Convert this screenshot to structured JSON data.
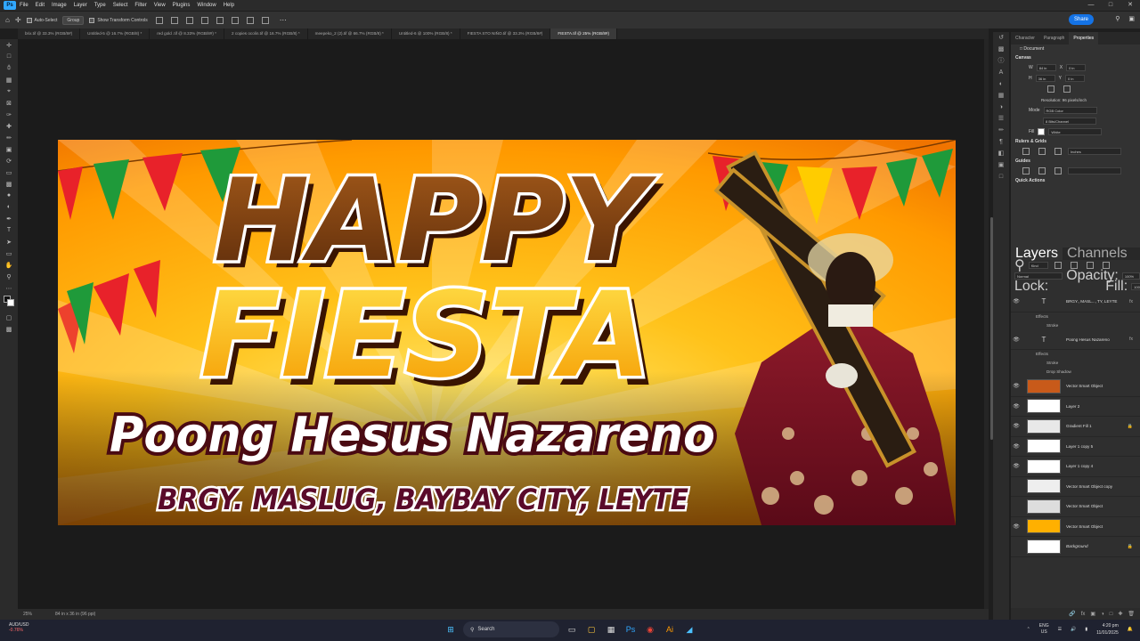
{
  "menubar": {
    "app_logo": "Ps",
    "items": [
      "File",
      "Edit",
      "Image",
      "Layer",
      "Type",
      "Select",
      "Filter",
      "View",
      "Plugins",
      "Window",
      "Help"
    ]
  },
  "optbar": {
    "auto_select_label": "Auto-Select",
    "auto_select_value": "Group",
    "transform_label": "Show Transform Controls",
    "share_label": "Share"
  },
  "tabs": [
    {
      "label": "brix.tif @ 33.3% (RGB/8#)"
    },
    {
      "label": "Untitled-5 @ 16.7% (RGB/8) *"
    },
    {
      "label": "red gold .tif @ 8.33% (RGB/8#) *"
    },
    {
      "label": "2 copies ocolin.tif @ 16.7% (RGB/8) *"
    },
    {
      "label": "meepeko_2 (2).tif @ 66.7% (RGB/8) *"
    },
    {
      "label": "Untitled-6 @ 100% (RGB/8) *"
    },
    {
      "label": "FIESTA STO NIÑO.tif @ 33.3% (RGB/8#)"
    },
    {
      "label": "FIESTA.tif @ 25% (RGB/8#)"
    }
  ],
  "artwork": {
    "line1": "HAPPY",
    "line2": "FIESTA",
    "line3": "Poong Hesus Nazareno",
    "line4": "BRGY. MASLUG, BAYBAY CITY, LEYTE"
  },
  "status": {
    "zoom": "25%",
    "doc_size": "84 in x 36 in (96 ppi)"
  },
  "panel": {
    "tabs": [
      "Character",
      "Paragraph",
      "Properties"
    ],
    "doc_label": "Document",
    "canvas_title": "Canvas",
    "w_label": "W",
    "w_value": "84 in",
    "h_label": "H",
    "h_value": "36 in",
    "x_label": "X",
    "x_value": "0 in",
    "y_label": "Y",
    "y_value": "0 in",
    "resolution": "Resolution: 96 pixels/inch",
    "mode_label": "Mode",
    "mode_value": "RGB Color",
    "bits_value": "8 Bits/Channel",
    "fill_label": "Fill",
    "fill_value": "White",
    "rulers_title": "Rulers & Grids",
    "rulers_unit": "Inches",
    "guides_title": "Guides",
    "quick_title": "Quick Actions"
  },
  "layers_panel": {
    "tabs": [
      "Layers",
      "Channels"
    ],
    "kind_label": "Kind",
    "blend_value": "Normal",
    "opacity_label": "Opacity:",
    "opacity_value": "100%",
    "lock_label": "Lock:",
    "fill_label": "Fill:",
    "fill_value": "100%",
    "layers": [
      {
        "name": "BRGY., MASL..., TY, LEYTE",
        "type": "text",
        "fx": "fx",
        "effects": [
          "Effects",
          "Stroke"
        ]
      },
      {
        "name": "Poong Hesus Nazareno",
        "type": "text",
        "fx": "fx",
        "effects": [
          "Effects",
          "Stroke",
          "Drop Shadow"
        ]
      },
      {
        "name": "Vector Smart Object",
        "type": "smart"
      },
      {
        "name": "Layer 2",
        "type": "pixel"
      },
      {
        "name": "Gradient Fill 1",
        "type": "pixel",
        "locked": true
      },
      {
        "name": "Layer 1 copy 5",
        "type": "pixel"
      },
      {
        "name": "Layer 1 copy 4",
        "type": "pixel"
      },
      {
        "name": "Vector Smart Object copy",
        "type": "smart"
      },
      {
        "name": "Vector Smart Object",
        "type": "smart"
      },
      {
        "name": "Vector Smart Object",
        "type": "smart"
      },
      {
        "name": "Background",
        "type": "bg",
        "locked": true
      }
    ]
  },
  "taskbar": {
    "ticker_name": "AUD/USD",
    "ticker_change": "-0.76%",
    "search_placeholder": "Search",
    "lang_line1": "ENG",
    "lang_line2": "US",
    "time": "4:20 pm",
    "date": "11/01/2025"
  }
}
